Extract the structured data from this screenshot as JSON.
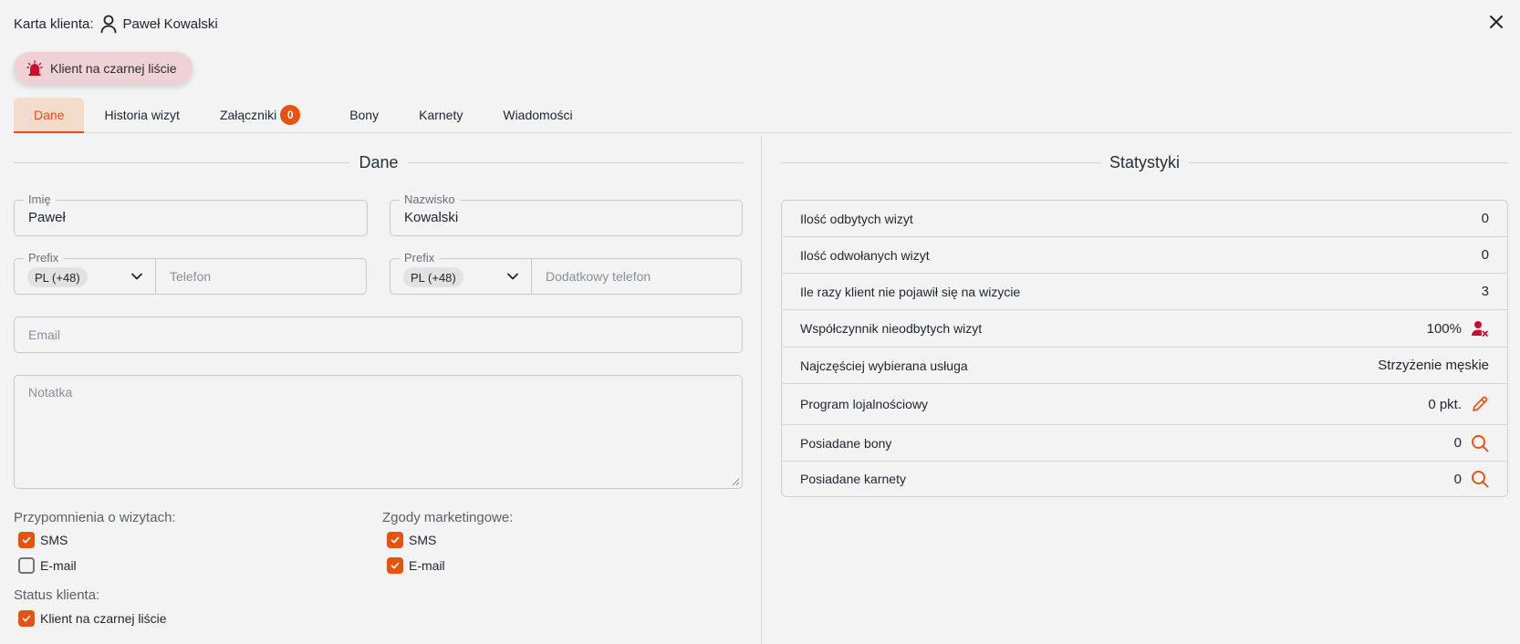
{
  "header": {
    "title_label": "Karta klienta:",
    "client_name": "Paweł Kowalski"
  },
  "badge": {
    "label": "Klient na czarnej liście"
  },
  "tabs": [
    {
      "label": "Dane",
      "active": true
    },
    {
      "label": "Historia wizyt"
    },
    {
      "label": "Załączniki",
      "count": "0"
    },
    {
      "label": "Bony"
    },
    {
      "label": "Karnety"
    },
    {
      "label": "Wiadomości"
    }
  ],
  "dane": {
    "heading": "Dane",
    "first_name": {
      "label": "Imię",
      "value": "Paweł"
    },
    "last_name": {
      "label": "Nazwisko",
      "value": "Kowalski"
    },
    "phone": {
      "prefix_label": "Prefix",
      "prefix_value": "PL (+48)",
      "placeholder": "Telefon"
    },
    "phone2": {
      "prefix_label": "Prefix",
      "prefix_value": "PL (+48)",
      "placeholder": "Dodatkowy telefon"
    },
    "email": {
      "placeholder": "Email"
    },
    "note": {
      "placeholder": "Notatka"
    },
    "reminders": {
      "label": "Przypomnienia o wizytach:",
      "sms": "SMS",
      "sms_checked": true,
      "email": "E-mail",
      "email_checked": false
    },
    "marketing": {
      "label": "Zgody marketingowe:",
      "sms": "SMS",
      "sms_checked": true,
      "email": "E-mail",
      "email_checked": true
    },
    "status": {
      "label": "Status klienta:",
      "blacklist": "Klient na czarnej liście",
      "blacklist_checked": true
    }
  },
  "stats": {
    "heading": "Statystyki",
    "rows": [
      {
        "label": "Ilość odbytych wizyt",
        "value": "0"
      },
      {
        "label": "Ilość odwołanych wizyt",
        "value": "0"
      },
      {
        "label": "Ile razy klient nie pojawił się na wizycie",
        "value": "3"
      },
      {
        "label": "Współczynnik nieodbytych wizyt",
        "value": "100%",
        "icon": "user-x-icon"
      },
      {
        "label": "Najczęściej wybierana usługa",
        "value": "Strzyżenie męskie"
      },
      {
        "label": "Program lojalnościowy",
        "value": "0 pkt.",
        "icon": "pencil-icon"
      },
      {
        "label": "Posiadane bony",
        "value": "0",
        "icon": "search-icon"
      },
      {
        "label": "Posiadane karnety",
        "value": "0",
        "icon": "search-icon"
      }
    ]
  },
  "colors": {
    "accent": "#e8520f",
    "badge_bg": "#efd2d6",
    "danger": "#c8102e"
  }
}
